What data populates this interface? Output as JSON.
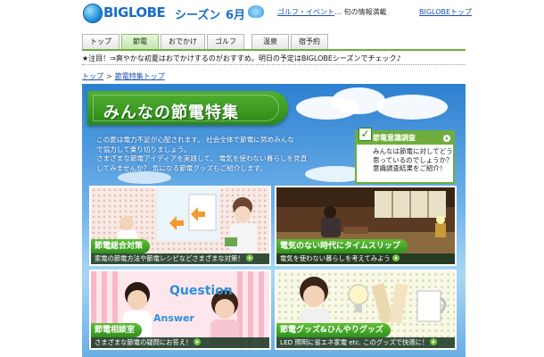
{
  "header": {
    "logo_text": "BIGLOBE",
    "logo_season": "シーズン",
    "logo_month": "6月",
    "tagline_link": "ゴルフ・イベント",
    "tagline_rest": "… 旬の情報満載",
    "top_link": "BIGLOBEトップ"
  },
  "tabs": [
    {
      "label": "トップ",
      "active": false
    },
    {
      "label": "節電",
      "active": true
    },
    {
      "label": "おでかけ",
      "active": false
    },
    {
      "label": "ゴルフ",
      "active": false
    },
    {
      "label": "温泉",
      "active": false
    },
    {
      "label": "宿予約",
      "active": false
    }
  ],
  "notice": "★注目！⇒爽やかな初夏はおでかけするのがおすすめ。明日の予定はBIGLOBEシーズンでチェック♪",
  "breadcrumb": {
    "home": "トップ",
    "separator": ">",
    "current": "節電特集トップ"
  },
  "main": {
    "title": "みんなの節電特集",
    "intro": [
      "この夏は電力不足が心配されます。 社会全体で節電に努めみんな",
      "で協力して乗り切りましょう。",
      "さまざまな節電アイディアを実践して、 電気を使わない暮らしを見直",
      "してみませんか？ 気になる節電グッズもご紹介します。"
    ],
    "survey": {
      "title": "節電意識調査",
      "body": "みんなは節電に対してどう思っているのでしょうか？意識調査結果をご紹介！"
    },
    "cards": [
      {
        "label": "節電総合対策",
        "caption": "家電の節電方法や節電レシピなどさまざまな対策！"
      },
      {
        "label": "電気のない時代にタイムスリップ",
        "caption": "電気を使わない暮らしを考えてみよう"
      },
      {
        "label": "節電相談室",
        "caption": "さまざまな節電の疑問にお答え！"
      },
      {
        "label": "節電グッズ&ひんやりグッズ",
        "caption": "LED 照明に省エネ家電 etc. このグッズで快適に！"
      }
    ],
    "card3_image_text": {
      "question": "Question",
      "answer": "Answer"
    }
  },
  "colors": {
    "brand_blue": "#1a6ec8",
    "accent_green": "#6fae3c",
    "link_blue": "#1a50b0"
  }
}
